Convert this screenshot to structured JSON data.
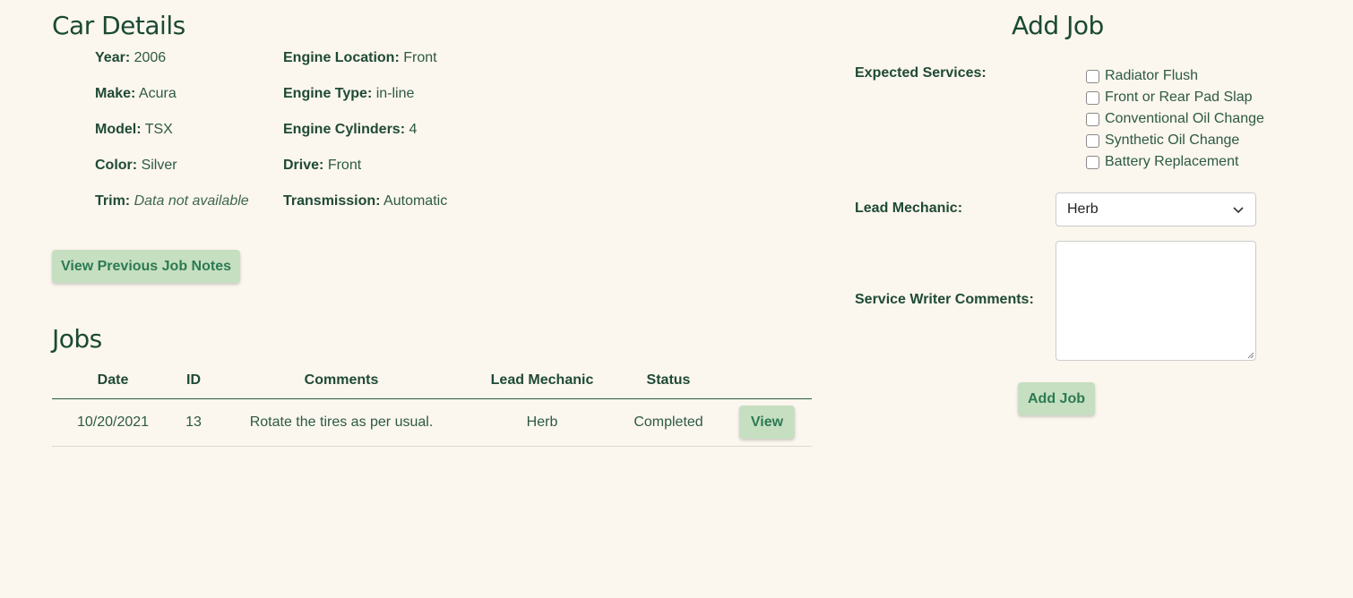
{
  "car_details": {
    "title": "Car Details",
    "year_label": "Year:",
    "year": "2006",
    "make_label": "Make:",
    "make": "Acura",
    "model_label": "Model:",
    "model": "TSX",
    "color_label": "Color:",
    "color": "Silver",
    "trim_label": "Trim:",
    "trim": "Data not available",
    "engine_location_label": "Engine Location:",
    "engine_location": "Front",
    "engine_type_label": "Engine Type:",
    "engine_type": "in-line",
    "engine_cylinders_label": "Engine Cylinders:",
    "engine_cylinders": "4",
    "drive_label": "Drive:",
    "drive": "Front",
    "transmission_label": "Transmission:",
    "transmission": "Automatic",
    "prev_notes_button": "View Previous Job Notes"
  },
  "jobs": {
    "title": "Jobs",
    "columns": [
      "Date",
      "ID",
      "Comments",
      "Lead Mechanic",
      "Status"
    ],
    "rows": [
      {
        "date": "10/20/2021",
        "id": "13",
        "comments": "Rotate the tires as per usual.",
        "mechanic": "Herb",
        "status": "Completed",
        "action": "View"
      }
    ]
  },
  "add_job": {
    "title": "Add Job",
    "services_label": "Expected Services:",
    "services": [
      "Radiator Flush",
      "Front or Rear Pad Slap",
      "Conventional Oil Change",
      "Synthetic Oil Change",
      "Battery Replacement"
    ],
    "mechanic_label": "Lead Mechanic:",
    "mechanic_value": "Herb",
    "comments_label": "Service Writer Comments:",
    "submit_label": "Add Job"
  },
  "colors": {
    "background": "#fbf6ee",
    "text": "#1f4a35",
    "button_bg": "#c6dfc1",
    "button_text": "#2c7a52"
  },
  "icons": {
    "select_chevron": "chevron-down-icon",
    "textarea_grip": "resize-grip-icon"
  }
}
